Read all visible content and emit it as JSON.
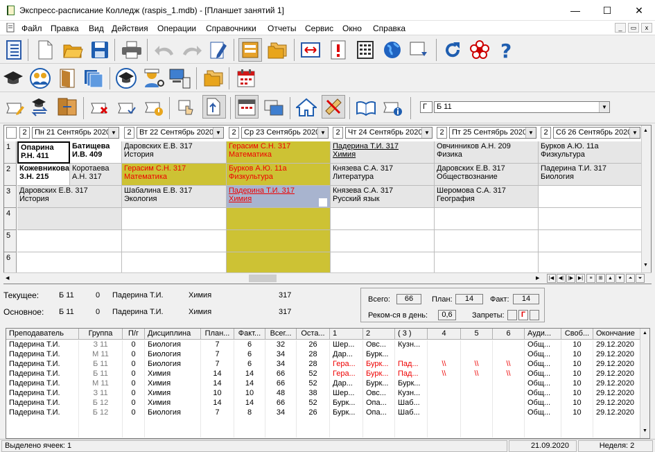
{
  "window": {
    "title": "Экспресс-расписание Колледж (raspis_1.mdb) - [Планшет занятий 1]",
    "min_glyph": "—",
    "max_glyph": "☐",
    "close_glyph": "✕"
  },
  "menu": [
    "Файл",
    "Правка",
    "Вид",
    "Действия",
    "Операции",
    "Справочники",
    "Отчеты",
    "Сервис",
    "Окно",
    "Справка"
  ],
  "mdi": {
    "min": "_",
    "restore": "▭",
    "close": "x"
  },
  "toolbar3": {
    "prefix": "Г",
    "group": "Б 11"
  },
  "days": [
    {
      "week": "2",
      "label": "Пн 21 Сентябрь 2020"
    },
    {
      "week": "2",
      "label": "Вт 22 Сентябрь 2020"
    },
    {
      "week": "2",
      "label": "Ср 23 Сентябрь 2020"
    },
    {
      "week": "2",
      "label": "Чт 24 Сентябрь 2020"
    },
    {
      "week": "2",
      "label": "Пт 25 Сентябрь 2020"
    },
    {
      "week": "2",
      "label": "Сб 26 Сентябрь 2020"
    }
  ],
  "rows": [
    "1",
    "2",
    "3",
    "4",
    "5",
    "6"
  ],
  "lessons": {
    "mon": [
      {
        "a1": "Опарина",
        "b1": "Р.Н.   411",
        "a2": "Батищева",
        "b2": "И.В.   409"
      },
      {
        "a1": "Кожевникова",
        "b1": "З.Н.   215",
        "a2": "Коротаева",
        "b2": "А.Н.  317"
      },
      {
        "l1": "Даровских Е.В.   317",
        "l2": "История"
      }
    ],
    "tue": [
      {
        "l1": "Даровских Е.В.   317",
        "l2": "История"
      },
      {
        "l1": "Герасим С.Н.   317",
        "l2": "Математика"
      },
      {
        "l1": "Шабалина Е.В.   317",
        "l2": "Экология"
      }
    ],
    "wed": [
      {
        "l1": "Герасим С.Н.   317",
        "l2": "Математика"
      },
      {
        "l1": "Бурков А.Ю.   11а",
        "l2": "Физкультура"
      },
      {
        "l1": "Падерина Т.И.   317",
        "l2": "Химия"
      }
    ],
    "thu": [
      {
        "l1": "Падерина Т.И.   317",
        "l2": "Химия"
      },
      {
        "l1": "Князева С.А.   317",
        "l2": "Литература"
      },
      {
        "l1": "Князева С.А.   317",
        "l2": "Русский язык"
      }
    ],
    "fri": [
      {
        "l1": "Овчинников А.Н.   209",
        "l2": "Физика"
      },
      {
        "l1": "Даровских Е.В.   317",
        "l2": "Обществознание"
      },
      {
        "l1": "Шеромова С.А.   317",
        "l2": "География"
      }
    ],
    "sat": [
      {
        "l1": "Бурков А.Ю.   11а",
        "l2": "Физкультура"
      },
      {
        "l1": "Падерина Т.И.   317",
        "l2": "Биология"
      }
    ]
  },
  "current": {
    "label": "Текущее:",
    "group": "Б 11",
    "sub": "0",
    "teacher": "Падерина Т.И.",
    "subject": "Химия",
    "room": "317"
  },
  "main": {
    "label": "Основное:",
    "group": "Б 11",
    "sub": "0",
    "teacher": "Падерина Т.И.",
    "subject": "Химия",
    "room": "317"
  },
  "stats": {
    "total_label": "Всего:",
    "total": "66",
    "plan_label": "План:",
    "plan": "14",
    "fact_label": "Факт:",
    "fact": "14",
    "rec_label": "Реком-ся в день:",
    "rec": "0,6",
    "ban_label": "Запреты:",
    "ban": "Г"
  },
  "table": {
    "headers": [
      "Преподаватель",
      "Группа",
      "П/г",
      "Дисциплина",
      "План...",
      "Факт...",
      "Всег...",
      "Оста...",
      "1",
      "2",
      "( 3 )",
      "4",
      "5",
      "6",
      "Ауди...",
      "Своб...",
      "Окончание"
    ],
    "rows": [
      [
        "Падерина Т.И.",
        "З 11",
        "0",
        "Биология",
        "7",
        "6",
        "32",
        "26",
        "Шер...",
        "Овс...",
        "Кузн...",
        "",
        "",
        "",
        "Общ...",
        "10",
        "29.12.2020"
      ],
      [
        "Падерина Т.И.",
        "М 11",
        "0",
        "Биология",
        "7",
        "6",
        "34",
        "28",
        "Дар...",
        "Бурк...",
        "",
        "",
        "",
        "",
        "Общ...",
        "10",
        "29.12.2020"
      ],
      [
        "Падерина Т.И.",
        "Б 11",
        "0",
        "Биология",
        "7",
        "6",
        "34",
        "28",
        "Гера...",
        "Бурк...",
        "Пад...",
        "\\\\",
        "\\\\",
        "\\\\",
        "Общ...",
        "10",
        "29.12.2020"
      ],
      [
        "Падерина Т.И.",
        "Б 11",
        "0",
        "Химия",
        "14",
        "14",
        "66",
        "52",
        "Гера...",
        "Бурк...",
        "Пад...",
        "\\\\",
        "\\\\",
        "\\\\",
        "Общ...",
        "10",
        "29.12.2020"
      ],
      [
        "Падерина Т.И.",
        "М 11",
        "0",
        "Химия",
        "14",
        "14",
        "66",
        "52",
        "Дар...",
        "Бурк...",
        "Бурк...",
        "",
        "",
        "",
        "Общ...",
        "10",
        "29.12.2020"
      ],
      [
        "Падерина Т.И.",
        "З 11",
        "0",
        "Химия",
        "10",
        "10",
        "48",
        "38",
        "Шер...",
        "Овс...",
        "Кузн...",
        "",
        "",
        "",
        "Общ...",
        "10",
        "29.12.2020"
      ],
      [
        "Падерина Т.И.",
        "Б 12",
        "0",
        "Химия",
        "14",
        "14",
        "66",
        "52",
        "Бурк...",
        "Опа...",
        "Шаб...",
        "",
        "",
        "",
        "Общ...",
        "10",
        "29.12.2020"
      ],
      [
        "Падерина Т.И.",
        "Б 12",
        "0",
        "Биология",
        "7",
        "8",
        "34",
        "26",
        "Бурк...",
        "Опа...",
        "Шаб...",
        "",
        "",
        "",
        "Общ...",
        "10",
        "29.12.2020"
      ]
    ]
  },
  "status": {
    "selected": "Выделено ячеек: 1",
    "date": "21.09.2020",
    "week": "Неделя: 2"
  },
  "colors": {
    "yellow": "#cdc234",
    "grey": "#e6e6e6",
    "blue": "#a8b4cf",
    "red": "#e00000"
  }
}
